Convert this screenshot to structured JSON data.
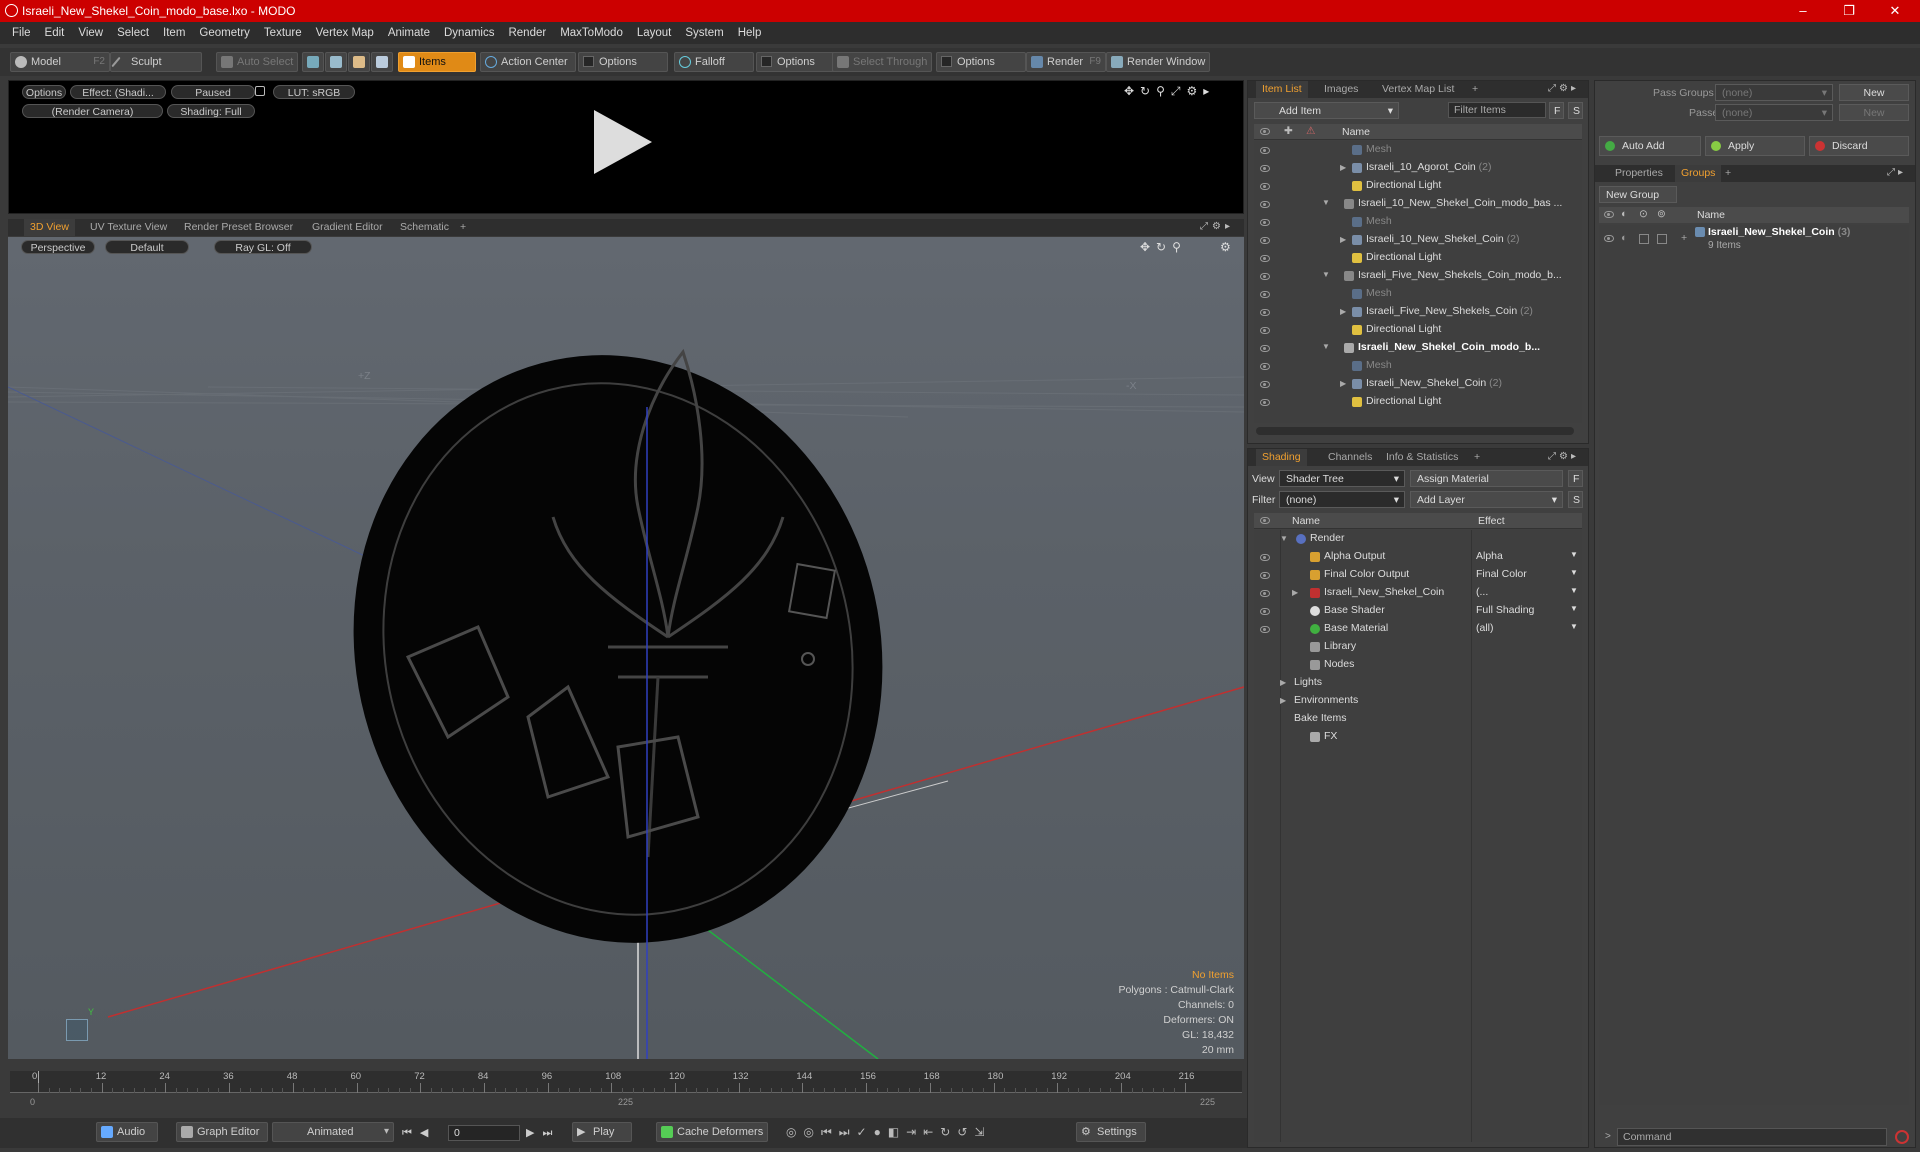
{
  "window": {
    "title": "Israeli_New_Shekel_Coin_modo_base.lxo - MODO",
    "controls": [
      "–",
      "❐",
      "✕"
    ]
  },
  "menu": [
    "File",
    "Edit",
    "View",
    "Select",
    "Item",
    "Geometry",
    "Texture",
    "Vertex Map",
    "Animate",
    "Dynamics",
    "Render",
    "MaxToModo",
    "Layout",
    "System",
    "Help"
  ],
  "toolbar": {
    "model": "Model",
    "model_key": "F2",
    "sculpt": "Sculpt",
    "auto_select": "Auto Select",
    "items": "Items",
    "action_center": "Action Center",
    "options1": "Options",
    "falloff": "Falloff",
    "options2": "Options",
    "select_through": "Select Through",
    "options3": "Options",
    "render": "Render",
    "render_key": "F9",
    "render_window": "Render Window"
  },
  "preview": {
    "options": "Options",
    "effect": "Effect: (Shadi...",
    "paused": "Paused",
    "lut": "LUT: sRGB",
    "camera": "(Render Camera)",
    "shading": "Shading: Full"
  },
  "viewport_tabs": [
    "3D View",
    "UV Texture View",
    "Render Preset Browser",
    "Gradient Editor",
    "Schematic",
    "+"
  ],
  "viewport": {
    "perspective": "Perspective",
    "default": "Default",
    "raygl": "Ray GL: Off",
    "axis_z": "+Z",
    "axis_x": "-X",
    "stats": {
      "no_items": "No Items",
      "polygons": "Polygons : Catmull-Clark",
      "channels": "Channels: 0",
      "deformers": "Deformers: ON",
      "gl": "GL: 18,432",
      "scale": "20 mm"
    },
    "gizmo_y": "Y"
  },
  "timeline": {
    "ticks": [
      "0",
      "12",
      "24",
      "36",
      "48",
      "60",
      "72",
      "84",
      "96",
      "108",
      "120",
      "132",
      "144",
      "156",
      "168",
      "180",
      "192",
      "204",
      "216"
    ],
    "start": "0",
    "mid": "225",
    "end": "225"
  },
  "transport": {
    "audio": "Audio",
    "graph_editor": "Graph Editor",
    "animated": "Animated",
    "frame": "0",
    "play": "Play",
    "cache": "Cache Deformers",
    "settings": "Settings"
  },
  "item_list": {
    "tabs": [
      "Item List",
      "Images",
      "Vertex Map List",
      "+"
    ],
    "add_item": "Add Item",
    "filter": "Filter Items",
    "f_btn": "F",
    "s_btn": "S",
    "col_name": "Name",
    "rows": [
      {
        "label": "Mesh",
        "count": "",
        "indent": 1,
        "kind": "mesh"
      },
      {
        "label": "Israeli_10_Agorot_Coin",
        "count": "(2)",
        "indent": 1,
        "kind": "item"
      },
      {
        "label": "Directional Light",
        "count": "",
        "indent": 1,
        "kind": "light"
      },
      {
        "label": "Israeli_10_New_Shekel_Coin_modo_bas ...",
        "count": "",
        "indent": 0,
        "kind": "group"
      },
      {
        "label": "Mesh",
        "count": "",
        "indent": 1,
        "kind": "mesh"
      },
      {
        "label": "Israeli_10_New_Shekel_Coin",
        "count": "(2)",
        "indent": 1,
        "kind": "item"
      },
      {
        "label": "Directional Light",
        "count": "",
        "indent": 1,
        "kind": "light"
      },
      {
        "label": "Israeli_Five_New_Shekels_Coin_modo_b...",
        "count": "",
        "indent": 0,
        "kind": "group"
      },
      {
        "label": "Mesh",
        "count": "",
        "indent": 1,
        "kind": "mesh"
      },
      {
        "label": "Israeli_Five_New_Shekels_Coin",
        "count": "(2)",
        "indent": 1,
        "kind": "item"
      },
      {
        "label": "Directional Light",
        "count": "",
        "indent": 1,
        "kind": "light"
      },
      {
        "label": "Israeli_New_Shekel_Coin_modo_b...",
        "count": "",
        "indent": 0,
        "kind": "group-bold"
      },
      {
        "label": "Mesh",
        "count": "",
        "indent": 1,
        "kind": "mesh"
      },
      {
        "label": "Israeli_New_Shekel_Coin",
        "count": "(2)",
        "indent": 1,
        "kind": "item"
      },
      {
        "label": "Directional Light",
        "count": "",
        "indent": 1,
        "kind": "light"
      }
    ]
  },
  "shading": {
    "tabs": [
      "Shading",
      "Channels",
      "Info & Statistics",
      "+"
    ],
    "view_label": "View",
    "view_value": "Shader Tree",
    "assign": "Assign Material",
    "f_btn": "F",
    "filter_label": "Filter",
    "filter_value": "(none)",
    "add_layer": "Add Layer",
    "s_btn": "S",
    "col_name": "Name",
    "col_effect": "Effect",
    "rows": [
      {
        "label": "Render",
        "effect": "",
        "indent": 0,
        "eye": false,
        "icon": "render-icon"
      },
      {
        "label": "Alpha Output",
        "effect": "Alpha",
        "indent": 1,
        "eye": true,
        "icon": "output-icon"
      },
      {
        "label": "Final Color Output",
        "effect": "Final Color",
        "indent": 1,
        "eye": true,
        "icon": "output-icon"
      },
      {
        "label": "Israeli_New_Shekel_Coin",
        "effect": "(...",
        "indent": 1,
        "eye": true,
        "icon": "material-icon"
      },
      {
        "label": "Base Shader",
        "effect": "Full Shading",
        "indent": 1,
        "eye": true,
        "icon": "shader-icon"
      },
      {
        "label": "Base Material",
        "effect": "(all)",
        "indent": 1,
        "eye": true,
        "icon": "basematerial-icon"
      },
      {
        "label": "Library",
        "effect": "",
        "indent": 2,
        "eye": false,
        "icon": "folder-icon"
      },
      {
        "label": "Nodes",
        "effect": "",
        "indent": 2,
        "eye": false,
        "icon": "folder-icon"
      },
      {
        "label": "Lights",
        "effect": "",
        "indent": 3,
        "eye": false,
        "icon": ""
      },
      {
        "label": "Environments",
        "effect": "",
        "indent": 3,
        "eye": false,
        "icon": ""
      },
      {
        "label": "Bake Items",
        "effect": "",
        "indent": 3,
        "eye": false,
        "icon": ""
      },
      {
        "label": "FX",
        "effect": "",
        "indent": 2,
        "eye": false,
        "icon": "fx-icon"
      }
    ]
  },
  "groups_panel": {
    "pass_groups_label": "Pass Groups",
    "pass_groups_value": "(none)",
    "new1": "New",
    "passes_label": "Passes",
    "passes_value": "(none)",
    "new2": "New",
    "auto_add": "Auto Add",
    "apply": "Apply",
    "discard": "Discard",
    "tabs": [
      "Properties",
      "Groups",
      "+"
    ],
    "new_group": "New Group",
    "col_name": "Name",
    "group_name": "Israeli_New_Shekel_Coin",
    "group_count": "(3)",
    "group_items": "9 Items"
  },
  "command": {
    "placeholder": "Command"
  }
}
